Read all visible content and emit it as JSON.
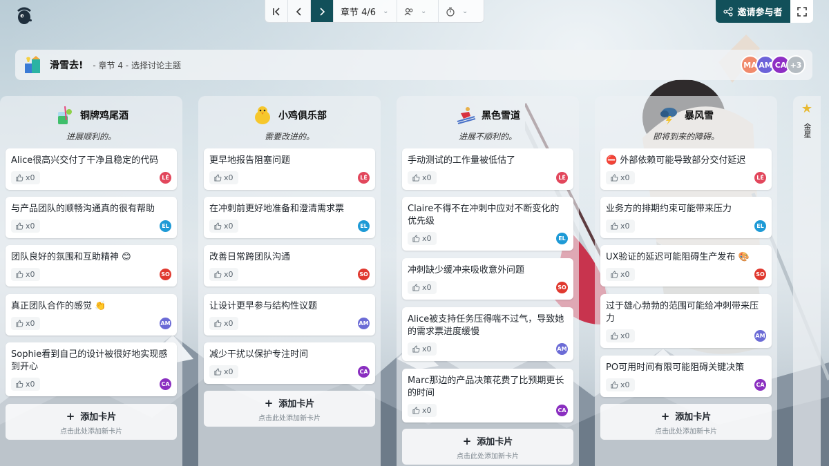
{
  "toolbar": {
    "chapter_label": "章节 4/6",
    "invite_label": "邀请参与者"
  },
  "header": {
    "title": "滑雪去!",
    "subtitle": "- 章节 4 - 选择讨论主题",
    "avatars": [
      {
        "initials": "MA",
        "color": "#f08a6c"
      },
      {
        "initials": "AM",
        "color": "#6c63d9"
      },
      {
        "initials": "CA",
        "color": "#8e2fc4"
      },
      {
        "initials": "+3",
        "color": "#b5bcc2"
      }
    ]
  },
  "colors": {
    "accent": "#12505a",
    "avatar_LE": "#e2475c",
    "avatar_EL": "#1e9ad6",
    "avatar_SO": "#e0392f",
    "avatar_AM": "#6b6bd6",
    "avatar_CA": "#8a2fc0"
  },
  "columns": [
    {
      "title": "铜牌鸡尾酒",
      "subtitle": "进展顺利的。",
      "icon": "cocktail-icon",
      "cards": [
        {
          "text": "Alice很高兴交付了干净且稳定的代码",
          "votes": "x0",
          "author": "LÉ"
        },
        {
          "text": "与产品团队的顺畅沟通真的很有帮助",
          "votes": "x0",
          "author": "EL"
        },
        {
          "text": "团队良好的氛围和互助精神 😊",
          "votes": "x0",
          "author": "SO"
        },
        {
          "text": "真正团队合作的感觉 👏",
          "votes": "x0",
          "author": "AM"
        },
        {
          "text": "Sophie看到自己的设计被很好地实现感到开心",
          "votes": "x0",
          "author": "CA"
        }
      ],
      "add_label": "添加卡片",
      "add_hint": "点击此处添加新卡片"
    },
    {
      "title": "小鸡俱乐部",
      "subtitle": "需要改进的。",
      "icon": "chick-icon",
      "cards": [
        {
          "text": "更早地报告阻塞问题",
          "votes": "x0",
          "author": "LÉ"
        },
        {
          "text": "在冲刺前更好地准备和澄清需求票",
          "votes": "x0",
          "author": "EL"
        },
        {
          "text": "改善日常跨团队沟通",
          "votes": "x0",
          "author": "SO"
        },
        {
          "text": "让设计更早参与结构性议题",
          "votes": "x0",
          "author": "AM"
        },
        {
          "text": "减少干扰以保护专注时间",
          "votes": "x0",
          "author": "CA"
        }
      ],
      "add_label": "添加卡片",
      "add_hint": "点击此处添加新卡片"
    },
    {
      "title": "黑色雪道",
      "subtitle": "进展不顺利的。",
      "icon": "skier-icon",
      "cards": [
        {
          "text": "手动测试的工作量被低估了",
          "votes": "x0",
          "author": "LÉ"
        },
        {
          "text": "Claire不得不在冲刺中应对不断变化的优先级",
          "votes": "x0",
          "author": "EL"
        },
        {
          "text": "冲刺缺少缓冲来吸收意外问题",
          "votes": "x0",
          "author": "SO"
        },
        {
          "text": "Alice被支持任务压得喘不过气，导致她的需求票进度缓慢",
          "votes": "x0",
          "author": "AM"
        },
        {
          "text": "Marc那边的产品决策花费了比预期更长的时间",
          "votes": "x0",
          "author": "CA"
        }
      ],
      "add_label": "添加卡片",
      "add_hint": "点击此处添加新卡片"
    },
    {
      "title": "暴风雪",
      "subtitle": "即将到来的障碍。",
      "icon": "storm-cloud-icon",
      "cards": [
        {
          "text": "⛔ 外部依赖可能导致部分交付延迟",
          "votes": "x0",
          "author": "LÉ"
        },
        {
          "text": "业务方的排期约束可能带来压力",
          "votes": "x0",
          "author": "EL"
        },
        {
          "text": "UX验证的延迟可能阻碍生产发布 🎨",
          "votes": "x0",
          "author": "SO"
        },
        {
          "text": "过于雄心勃勃的范围可能给冲刺带来压力",
          "votes": "x0",
          "author": "AM"
        },
        {
          "text": "PO可用时间有限可能阻碍关键决策",
          "votes": "x0",
          "author": "CA"
        }
      ],
      "add_label": "添加卡片",
      "add_hint": "点击此处添加新卡片"
    }
  ],
  "side_panel": {
    "label": "金星"
  }
}
